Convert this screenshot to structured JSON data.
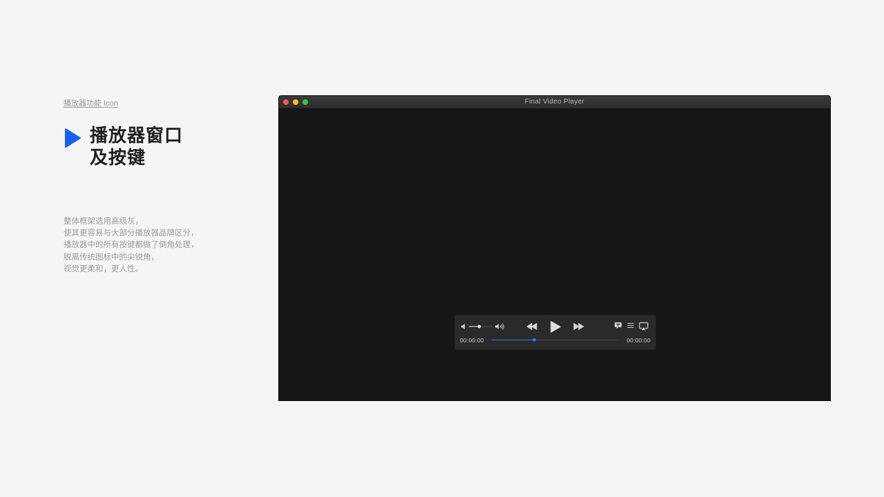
{
  "intro": {
    "section_label": "播放器功能 Icon",
    "heading_line1": "播放器窗口",
    "heading_line2": "及按键",
    "description": [
      "整体框架选用高级灰，",
      "使其更容易与大部分播放器品牌区分，",
      "播放器中的所有按键都做了倒角处理，",
      "脱离传统图标中的尖锐角，",
      "视觉更柔和，更人性。"
    ],
    "accent_color": "#1a5ff0"
  },
  "player": {
    "window_title": "Final Video Player",
    "window_buttons": [
      "close",
      "minimize",
      "maximize"
    ],
    "controls": {
      "volume_icons": [
        "volume-low-icon",
        "volume-high-icon"
      ],
      "volume_level": 0.45,
      "transport_icons": [
        "rewind-icon",
        "play-icon",
        "fast-forward-icon"
      ],
      "extra_icons": [
        "subtitle-icon",
        "playlist-icon",
        "airplay-icon"
      ],
      "current_time": "00:00:00",
      "total_time": "00:00:00",
      "progress": 0.33,
      "progress_color": "#1e7cf0"
    }
  }
}
